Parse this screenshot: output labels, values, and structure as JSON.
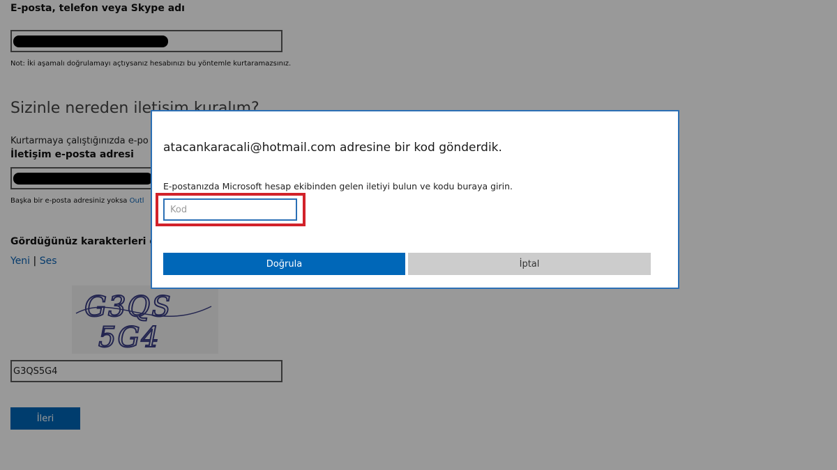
{
  "background": {
    "email_label": "E-posta, telefon veya Skype adı",
    "email_note": "Not: İki aşamalı doğrulamayı açtıysanız hesabınızı bu yöntemle kurtaramazsınız.",
    "contact_heading": "Sizinle nereden iletişim kuralım?",
    "contact_desc": "Kurtarmaya çalıştığınızda e-po",
    "contact_email_label": "İletişim e-posta adresi",
    "alt_email_prefix": "Başka bir e-posta adresiniz yoksa",
    "alt_email_link": "Outl",
    "captcha_label": "Gördüğünüz karakterleri girin",
    "new_link": "Yeni",
    "separator": "|",
    "audio_link": "Ses",
    "captcha_line1": "G3QS",
    "captcha_line2": "5G4",
    "captcha_value": "G3QS5G4",
    "next_button": "İleri"
  },
  "dialog": {
    "title": "atacankaracali@hotmail.com adresine bir kod gönderdik.",
    "instruction": "E-postanızda Microsoft hesap ekibinden gelen iletiyi bulun ve kodu buraya girin.",
    "code_placeholder": "Kod",
    "code_value": "",
    "verify_button": "Doğrula",
    "cancel_button": "İptal"
  },
  "colors": {
    "overlay": "rgba(0,0,0,0.40)",
    "primary_button": "#0067b8",
    "dialog_border": "#2b6fb5",
    "highlight": "#d2222a",
    "link": "#0b63b5"
  }
}
